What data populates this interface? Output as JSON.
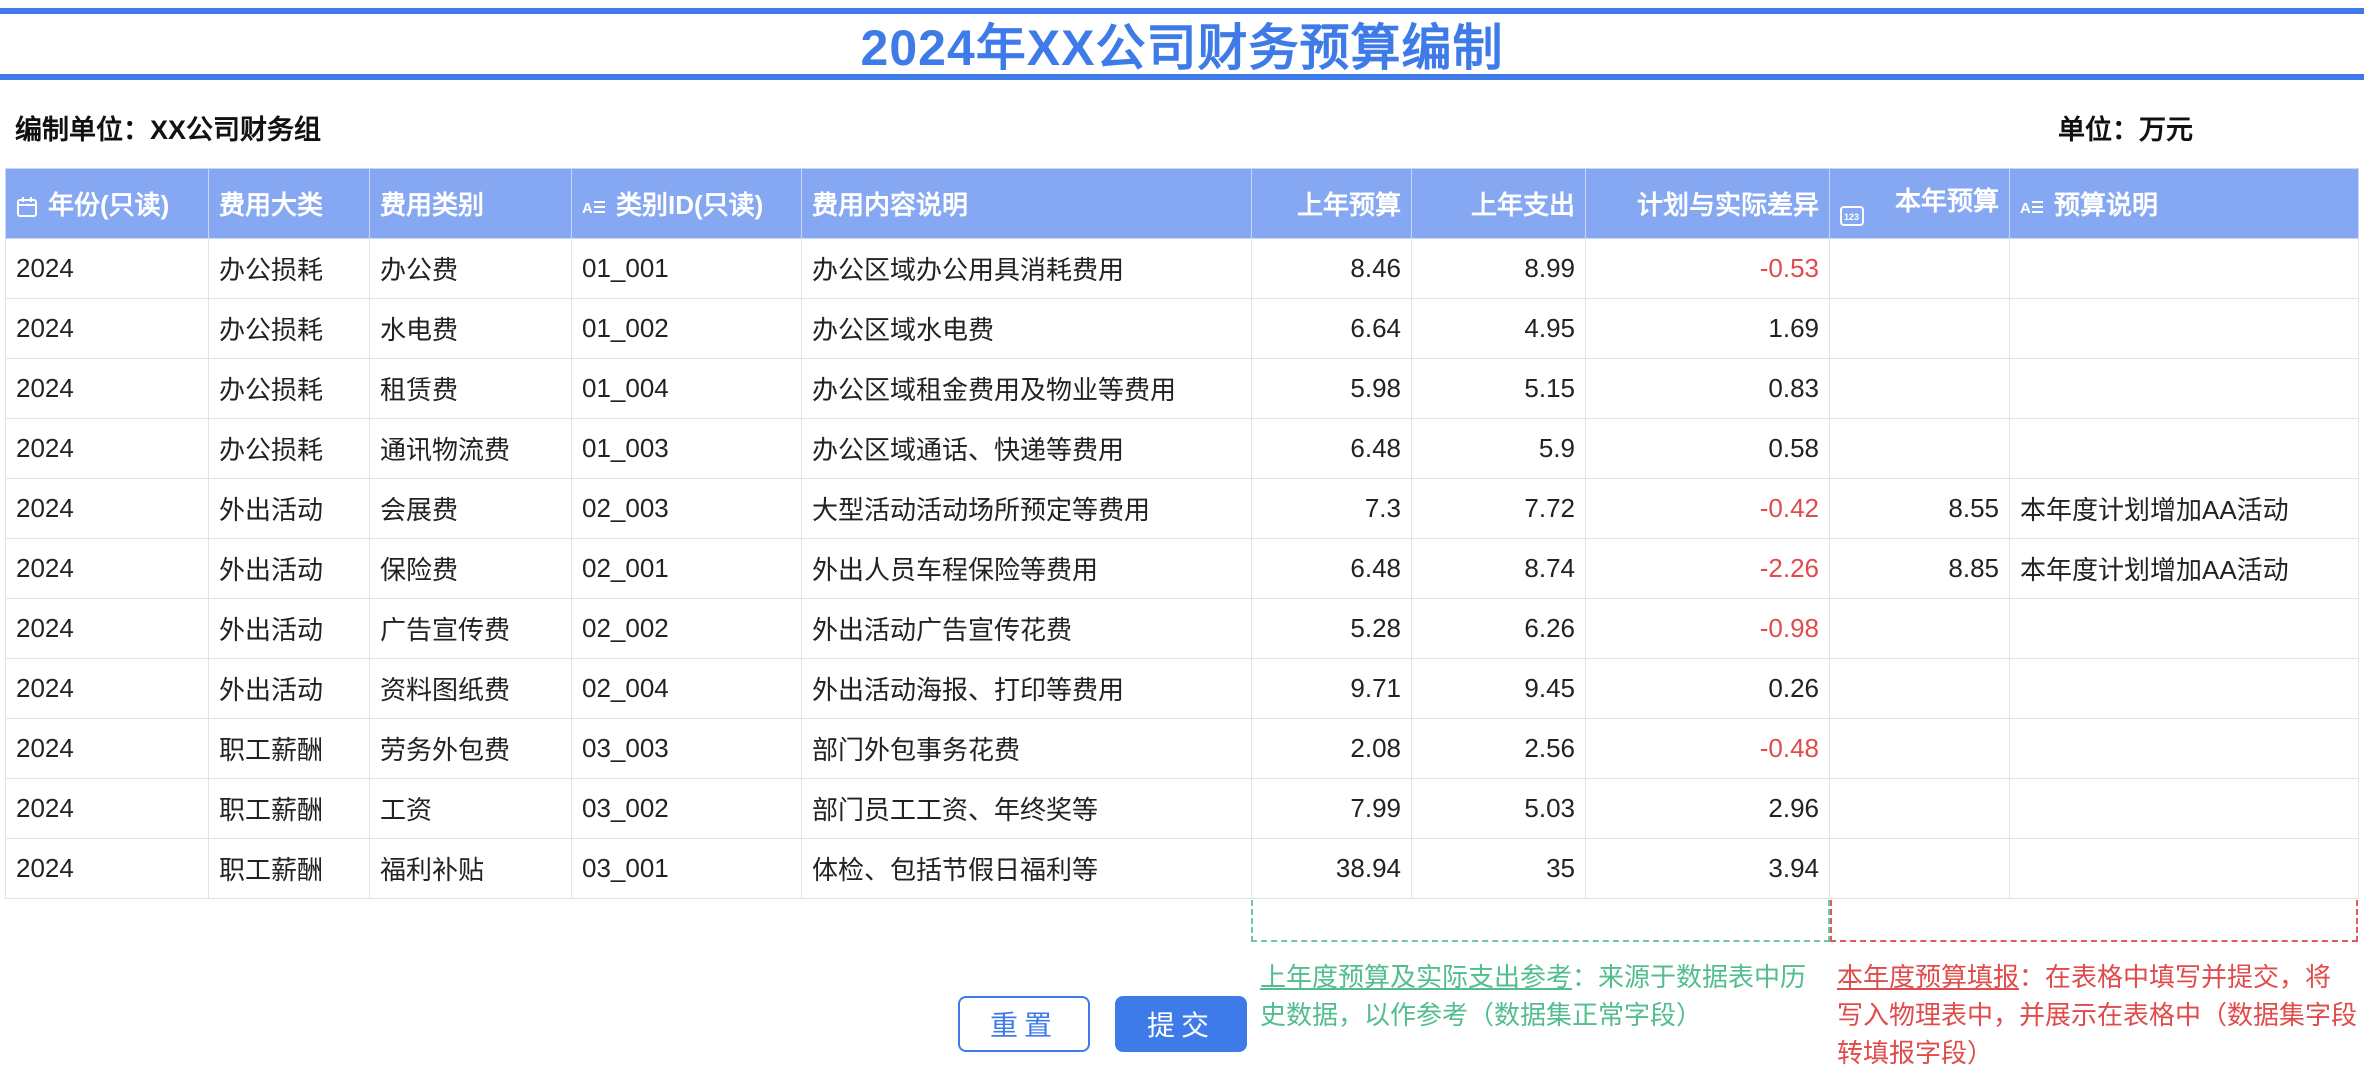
{
  "title": "2024年XX公司财务预算编制",
  "meta": {
    "org_label": "编制单位：XX公司财务组",
    "unit_label": "单位：万元"
  },
  "columns": [
    {
      "label": "年份(只读)",
      "icon": "calendar-icon"
    },
    {
      "label": "费用大类",
      "icon": ""
    },
    {
      "label": "费用类别",
      "icon": ""
    },
    {
      "label": "类别ID(只读)",
      "icon": "text-field-icon"
    },
    {
      "label": "费用内容说明",
      "icon": ""
    },
    {
      "label": "上年预算",
      "icon": ""
    },
    {
      "label": "上年支出",
      "icon": ""
    },
    {
      "label": "计划与实际差异",
      "icon": ""
    },
    {
      "label": "本年预算",
      "icon": "number-field-icon"
    },
    {
      "label": "预算说明",
      "icon": "text-field-icon"
    }
  ],
  "rows": [
    [
      "2024",
      "办公损耗",
      "办公费",
      "01_001",
      "办公区域办公用具消耗费用",
      "8.46",
      "8.99",
      "-0.53",
      "",
      ""
    ],
    [
      "2024",
      "办公损耗",
      "水电费",
      "01_002",
      "办公区域水电费",
      "6.64",
      "4.95",
      "1.69",
      "",
      ""
    ],
    [
      "2024",
      "办公损耗",
      "租赁费",
      "01_004",
      "办公区域租金费用及物业等费用",
      "5.98",
      "5.15",
      "0.83",
      "",
      ""
    ],
    [
      "2024",
      "办公损耗",
      "通讯物流费",
      "01_003",
      "办公区域通话、快递等费用",
      "6.48",
      "5.9",
      "0.58",
      "",
      ""
    ],
    [
      "2024",
      "外出活动",
      "会展费",
      "02_003",
      "大型活动活动场所预定等费用",
      "7.3",
      "7.72",
      "-0.42",
      "8.55",
      "本年度计划增加AA活动"
    ],
    [
      "2024",
      "外出活动",
      "保险费",
      "02_001",
      "外出人员车程保险等费用",
      "6.48",
      "8.74",
      "-2.26",
      "8.85",
      "本年度计划增加AA活动"
    ],
    [
      "2024",
      "外出活动",
      "广告宣传费",
      "02_002",
      "外出活动广告宣传花费",
      "5.28",
      "6.26",
      "-0.98",
      "",
      ""
    ],
    [
      "2024",
      "外出活动",
      "资料图纸费",
      "02_004",
      "外出活动海报、打印等费用",
      "9.71",
      "9.45",
      "0.26",
      "",
      ""
    ],
    [
      "2024",
      "职工薪酬",
      "劳务外包费",
      "03_003",
      "部门外包事务花费",
      "2.08",
      "2.56",
      "-0.48",
      "",
      ""
    ],
    [
      "2024",
      "职工薪酬",
      "工资",
      "03_002",
      "部门员工工资、年终奖等",
      "7.99",
      "5.03",
      "2.96",
      "",
      ""
    ],
    [
      "2024",
      "职工薪酬",
      "福利补贴",
      "03_001",
      "体检、包括节假日福利等",
      "38.94",
      "35",
      "3.94",
      "",
      ""
    ]
  ],
  "notes": {
    "green_head": "上年度预算及实际支出参考",
    "green_body": "：来源于数据表中历史数据，以作参考（数据集正常字段）",
    "red_head": "本年度预算填报",
    "red_body": "：在表格中填写并提交，将写入物理表中，并展示在表格中（数据集字段转填报字段）"
  },
  "buttons": {
    "reset": "重置",
    "submit": "提交"
  },
  "colors": {
    "accent": "#3f7be8",
    "header_bg": "#86a7f1",
    "negative": "#e04b4b",
    "note_green": "#52bd8e"
  }
}
